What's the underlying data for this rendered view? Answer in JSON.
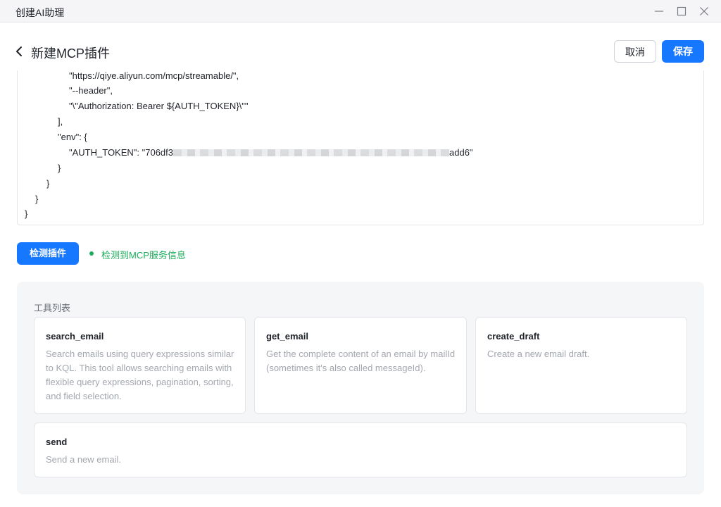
{
  "window": {
    "title": "创建AI助理"
  },
  "header": {
    "title": "新建MCP插件",
    "cancel_label": "取消",
    "save_label": "保存"
  },
  "code": {
    "line1": "\"https://qiye.aliyun.com/mcp/streamable/\",",
    "line2": "\"--header\",",
    "line3": "\"\\\"Authorization: Bearer ${AUTH_TOKEN}\\\"\"",
    "line4": "],",
    "line5": "\"env\": {",
    "line6_prefix": "\"AUTH_TOKEN\": \"706df3",
    "line6_suffix": "add6\"",
    "line7": "}",
    "line8": "}",
    "line9": "}",
    "line10": "}"
  },
  "detect": {
    "button_label": "检测插件",
    "status_text": "检测到MCP服务信息",
    "status_color": "#1aad5a"
  },
  "tools": {
    "label": "工具列表",
    "items": [
      {
        "name": "search_email",
        "description": "Search emails using query expressions similar to KQL. This tool allows searching emails with flexible query expressions, pagination, sorting, and field selection."
      },
      {
        "name": "get_email",
        "description": "Get the complete content of an email by mailId (sometimes it's also called messageId)."
      },
      {
        "name": "create_draft",
        "description": "Create a new email draft."
      },
      {
        "name": "send",
        "description": "Send a new email."
      }
    ]
  },
  "colors": {
    "accent": "#1677ff"
  }
}
